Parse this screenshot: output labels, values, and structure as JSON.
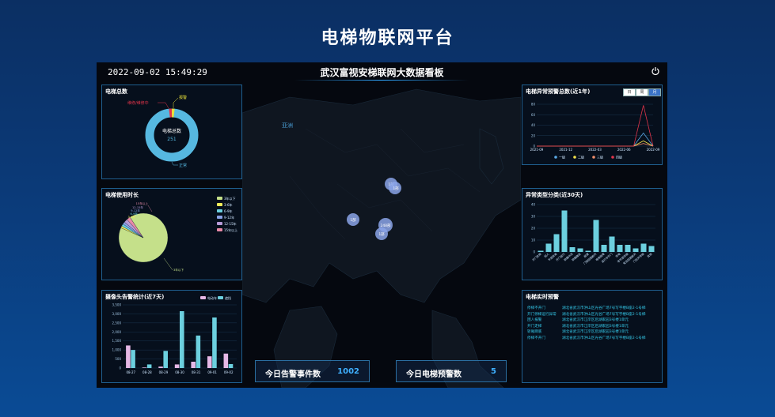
{
  "page_title": "电梯物联网平台",
  "header": {
    "clock": "2022-09-02 15:49:29",
    "title": "武汉富视安梯联网大数据看板"
  },
  "map": {
    "region_label": "亚洲",
    "clusters": [
      {
        "label": "1部"
      },
      {
        "label": "1部"
      },
      {
        "label": "1部"
      },
      {
        "label": "248部"
      },
      {
        "label": "1部"
      }
    ]
  },
  "elevator_total": {
    "title": "电梯总数",
    "center_label": "电梯总数",
    "center_value": "251",
    "legend": {
      "alarm": "报警",
      "repair": "维修/维修中",
      "normal": "正常"
    }
  },
  "elevator_usage": {
    "title": "电梯使用时长",
    "legend": [
      "3年以下",
      "3-6年",
      "6-9年",
      "9-12年",
      "12-15年",
      "15年以上"
    ],
    "slice_labels": [
      "15年以上",
      "12-15年",
      "9-12年",
      "6-9年",
      "3-6年",
      "3年以下"
    ]
  },
  "camera_alarm": {
    "title": "摄像头告警统计(近7天)",
    "legend": [
      "电动车",
      "遮挡"
    ]
  },
  "anomaly_trend": {
    "title": "电梯异常预警总数(近1年)",
    "tabs": [
      "日",
      "周",
      "月"
    ],
    "legend": [
      "一级",
      "二级",
      "三级",
      "四级"
    ]
  },
  "anomaly_types": {
    "title": "异常类型分类(近30天)",
    "categories": [
      "开门走梯",
      "困人",
      "平层异常",
      "开门运行",
      "轿厢冲顶",
      "轿厢蹲底",
      "超速",
      "门锁回路断开",
      "电梯故障",
      "运行中开门",
      "停电",
      "非平层停梯",
      "安全回路断开",
      "门区外停梯",
      "其他"
    ]
  },
  "realtime_alarm": {
    "title": "电梯实时预警",
    "rows": [
      {
        "type": "停梯不开门",
        "desc": "湖北省武汉市洪山区光谷广场7号写字楼B座2-1号梯"
      },
      {
        "type": "开门停梯运行异常",
        "desc": "湖北省武汉市洪山区光谷广场7号写字楼B座2-1号梯"
      },
      {
        "type": "困人报警",
        "desc": "湖北省武汉市江岸区后湖家园3号楼1单元"
      },
      {
        "type": "开门走梯",
        "desc": "湖北省武汉市江岸区后湖家园3号楼1单元"
      },
      {
        "type": "轿厢蹲底",
        "desc": "湖北省武汉市江岸区后湖家园3号楼1单元"
      },
      {
        "type": "停梯不开门",
        "desc": "湖北省武汉市洪山区光谷广场7号写字楼B座2-1号梯"
      }
    ]
  },
  "stats": {
    "today_alarms_label": "今日告警事件数",
    "today_alarms_value": "1002",
    "today_warnings_label": "今日电梯预警数",
    "today_warnings_value": "5"
  },
  "chart_data": [
    {
      "type": "pie",
      "title": "电梯总数",
      "categories": [
        "正常",
        "报警",
        "维修/维修中"
      ],
      "values": [
        249,
        1,
        1
      ],
      "colors": [
        "#56b8e0",
        "#e8e03a",
        "#e0344a"
      ]
    },
    {
      "type": "pie",
      "title": "电梯使用时长",
      "categories": [
        "3年以下",
        "3-6年",
        "6-9年",
        "9-12年",
        "12-15年",
        "15年以上"
      ],
      "values": [
        228,
        3,
        4,
        4,
        6,
        6
      ],
      "colors": [
        "#c5e08a",
        "#f0ec5a",
        "#6cd0df",
        "#8aa3e8",
        "#b79bd8",
        "#e88aa8"
      ]
    },
    {
      "type": "bar",
      "title": "摄像头告警统计(近7天)",
      "categories": [
        "08-27",
        "08-28",
        "08-29",
        "08-30",
        "08-31",
        "09-01",
        "09-02"
      ],
      "series": [
        {
          "name": "电动车",
          "values": [
            1250,
            30,
            80,
            200,
            350,
            650,
            800
          ],
          "color": "#e6b8e6"
        },
        {
          "name": "遮挡",
          "values": [
            1000,
            200,
            950,
            3150,
            1800,
            2800,
            220
          ],
          "color": "#6cd0df"
        }
      ],
      "ylim": [
        0,
        3500
      ],
      "yticks": [
        0,
        500,
        1000,
        1500,
        2000,
        2500,
        3000,
        3500
      ],
      "ytick_labels": [
        "0",
        "500",
        "1,000",
        "1,500",
        "2,000",
        "2,500",
        "3,000",
        "3,500"
      ]
    },
    {
      "type": "line",
      "title": "电梯异常预警总数(近1年)",
      "x": [
        "2021-09",
        "2021-10",
        "2021-11",
        "2021-12",
        "2022-01",
        "2022-02",
        "2022-03",
        "2022-04",
        "2022-05",
        "2022-06",
        "2022-07",
        "2022-08",
        "2022-09"
      ],
      "x_tick_labels": [
        "2021-09",
        "2021-12",
        "2022-03",
        "2022-06",
        "2022-09"
      ],
      "series": [
        {
          "name": "一级",
          "values": [
            0,
            0,
            0,
            0,
            0,
            0,
            0,
            0,
            0,
            0,
            0,
            25,
            0
          ],
          "color": "#5aa9e6"
        },
        {
          "name": "二级",
          "values": [
            0,
            0,
            0,
            0,
            0,
            0,
            0,
            0,
            0,
            0,
            0,
            10,
            0
          ],
          "color": "#f2e14a"
        },
        {
          "name": "三级",
          "values": [
            0,
            0,
            0,
            0,
            0,
            0,
            0,
            0,
            0,
            0,
            0,
            5,
            0
          ],
          "color": "#ef8d6a"
        },
        {
          "name": "四级",
          "values": [
            0,
            0,
            0,
            0,
            0,
            0,
            0,
            0,
            0,
            0,
            0,
            78,
            0
          ],
          "color": "#e0344a"
        }
      ],
      "ylim": [
        0,
        80
      ],
      "yticks": [
        0,
        20,
        40,
        60,
        80
      ]
    },
    {
      "type": "bar",
      "title": "异常类型分类(近30天)",
      "categories": [
        "开门走梯",
        "困人",
        "平层异常",
        "开门运行",
        "轿厢冲顶",
        "轿厢蹲底",
        "超速",
        "门锁回路断开",
        "电梯故障",
        "运行中开门",
        "停电",
        "非平层停梯",
        "安全回路断开",
        "门区外停梯",
        "其他"
      ],
      "values": [
        1,
        7,
        15,
        35,
        4,
        3,
        1,
        27,
        6,
        13,
        6,
        6,
        3,
        7,
        5
      ],
      "color": "#6cd0df",
      "ylim": [
        0,
        40
      ],
      "yticks": [
        0,
        10,
        20,
        30,
        40
      ]
    }
  ]
}
